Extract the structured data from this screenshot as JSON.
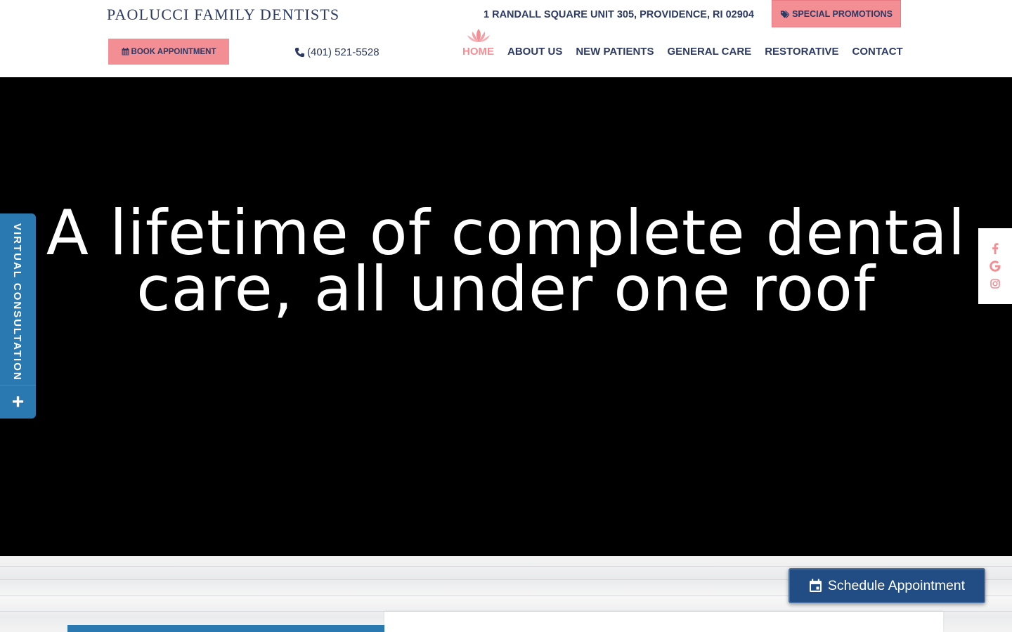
{
  "header": {
    "brand": "PAOLUCCI FAMILY DENTISTS",
    "address": "1 RANDALL SQUARE UNIT 305, PROVIDENCE, RI 02904",
    "promo_label": "SPECIAL PROMOTIONS",
    "book_label": "BOOK APPOINTMENT",
    "phone": "(401) 521-5528"
  },
  "nav": {
    "items": [
      {
        "label": "HOME",
        "active": true
      },
      {
        "label": "ABOUT US",
        "active": false
      },
      {
        "label": "NEW PATIENTS",
        "active": false
      },
      {
        "label": "GENERAL CARE",
        "active": false
      },
      {
        "label": "RESTORATIVE",
        "active": false
      },
      {
        "label": "CONTACT",
        "active": false
      }
    ]
  },
  "hero": {
    "title_line1": "A lifetime of complete dental",
    "title_line2": "care, all under one roof"
  },
  "virtual_consultation": {
    "label": "VIRTUAL CONSULTATION",
    "toggle_symbol": "+"
  },
  "social": {
    "icons": [
      "facebook-icon",
      "google-icon",
      "instagram-icon"
    ]
  },
  "schedule": {
    "label": "Schedule Appointment"
  },
  "colors": {
    "brand_navy": "#2c3a64",
    "accent_pink": "#f28e94",
    "tab_blue": "#2a79b0",
    "button_navy": "#214d84"
  }
}
